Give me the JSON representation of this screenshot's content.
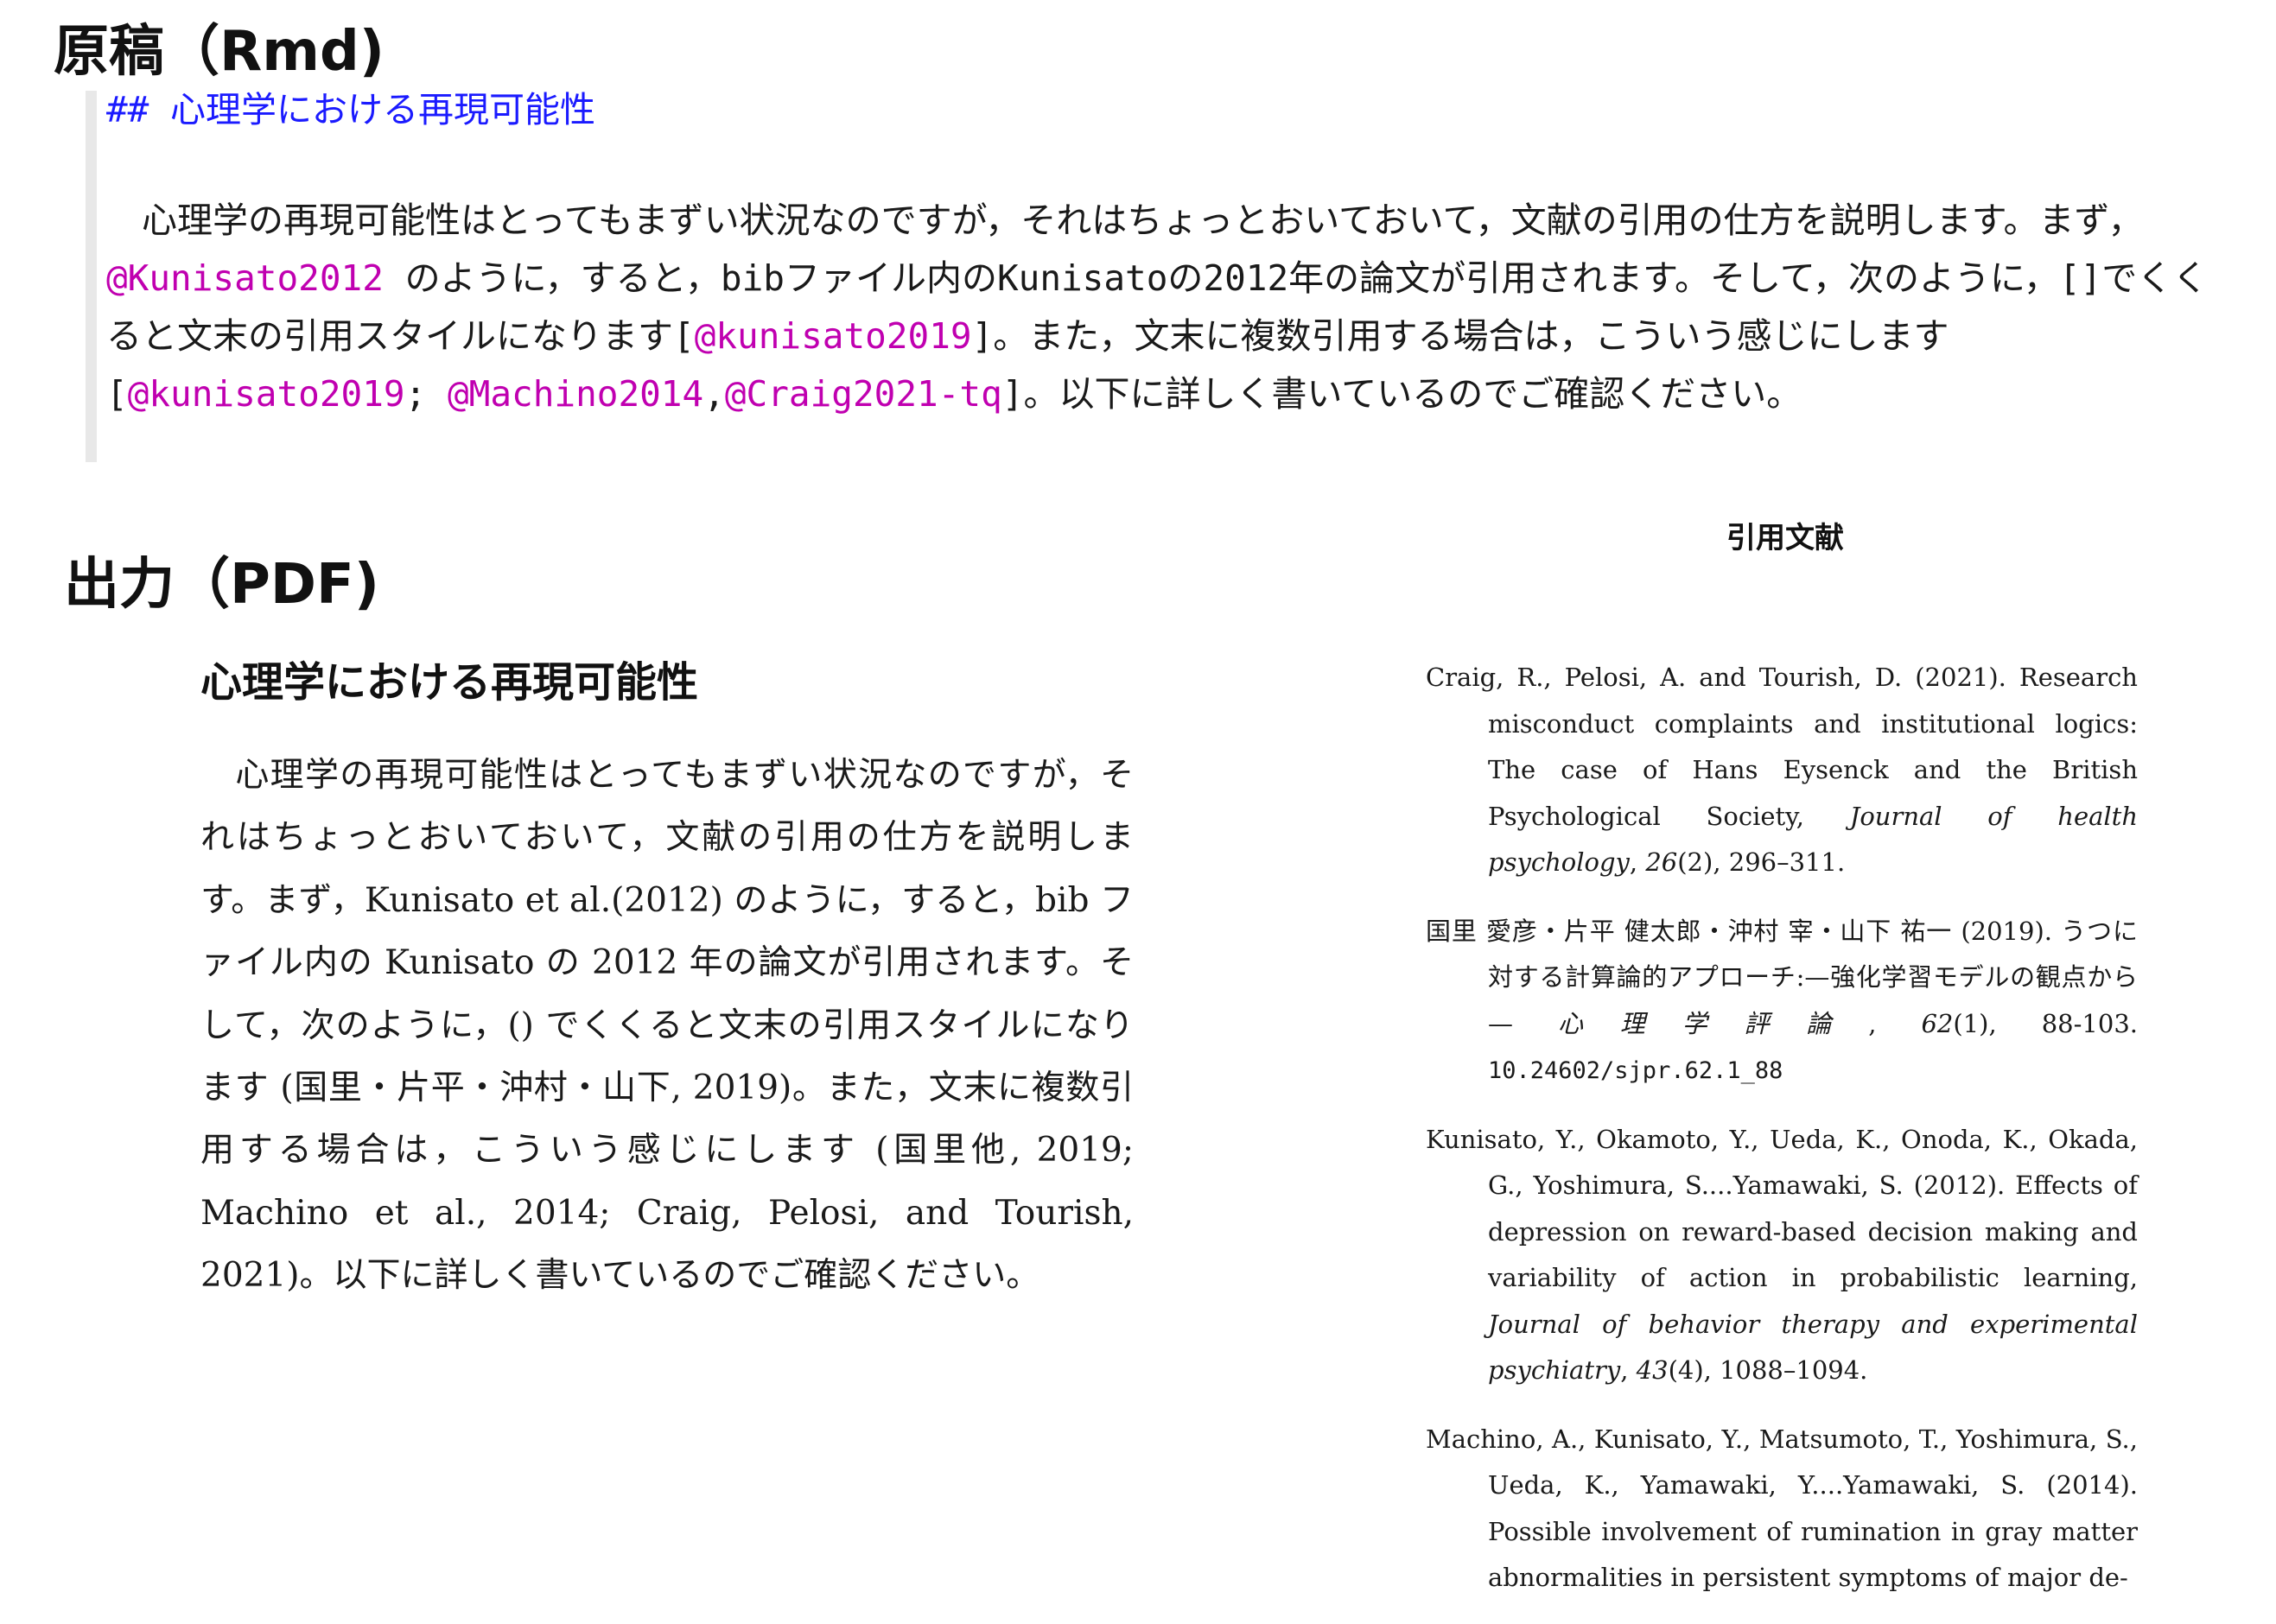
{
  "rmd_section": {
    "heading": "原稿（Rmd)",
    "source_heading": "## 心理学における再現可能性",
    "source_body": [
      {
        "text": "　心理学の再現可能性はとってもまずい状況なのですが，それはちょっとおいておいて，文献の引用の仕方を説明します。まず，"
      },
      {
        "cite": "@Kunisato2012"
      },
      {
        "text": " のように，すると，bibファイル内のKunisatoの2012年の論文が引用されます。そして，次のように，[]でくくると文末の引用スタイルになります["
      },
      {
        "cite": "@kunisato2019"
      },
      {
        "text": "]。また，文末に複数引用する場合は，こういう感じにします["
      },
      {
        "cite": "@kunisato2019"
      },
      {
        "text": "; "
      },
      {
        "cite": "@Machino2014"
      },
      {
        "text": ","
      },
      {
        "cite": "@Craig2021-tq"
      },
      {
        "text": "]。以下に詳しく書いているのでご確認ください。"
      }
    ]
  },
  "pdf_section": {
    "heading": "出力（PDF)",
    "title": "心理学における再現可能性",
    "body": "　心理学の再現可能性はとってもまずい状況なのですが，それはちょっとおいておいて，文献の引用の仕方を説明します。まず，Kunisato et al.(2012) のように，すると，bib ファイル内の Kunisato の 2012 年の論文が引用されます。そして，次のように，() でくくると文末の引用スタイルになります (国里・片平・沖村・山下, 2019)。また，文末に複数引用する場合は，こういう感じにします (国里他, 2019; Machino et al., 2014; Craig, Pelosi, and Tourish, 2021)。以下に詳しく書いているのでご確認ください。"
  },
  "references": {
    "heading": "引用文献",
    "items": [
      {
        "authors": "Craig, R., Pelosi, A. and Tourish, D. (2021). ",
        "title": "Research misconduct complaints and institutional logics: The case of Hans Eysenck and the British Psychological Society, ",
        "journal": "Journal of health psychology",
        "volume_text": ", ",
        "volume": "26",
        "rest": "(2), 296–311."
      },
      {
        "authors": "国里 愛彦・片平 健太郎・沖村 宰・山下 祐一 (2019). ",
        "title": "うつに対する計算論的アプローチ:—強化学習モデルの観点から— ",
        "journal": "心理学評論",
        "volume_text": ", ",
        "volume": "62",
        "rest": "(1), 88-103. ",
        "doi": "10.24602/sjpr.62.1_88"
      },
      {
        "authors": "Kunisato, Y., Okamoto, Y., Ueda, K., Onoda, K., Okada, G., Yoshimura, S....Yamawaki, S. (2012). ",
        "title": "Effects of depression on reward-based decision making and variability of action in probabilistic learning, ",
        "journal": "Journal of behavior therapy and experimental psychiatry",
        "volume_text": ", ",
        "volume": "43",
        "rest": "(4), 1088–1094."
      },
      {
        "authors": "Machino, A., Kunisato, Y., Matsumoto, T., Yoshimura, S., Ueda, K., Yamawaki, Y....Yamawaki, S. (2014). ",
        "title": "Possible involvement of rumination in gray matter abnormalities in persistent symptoms of major de-",
        "journal": "",
        "volume_text": "",
        "volume": "",
        "rest": ""
      }
    ]
  }
}
